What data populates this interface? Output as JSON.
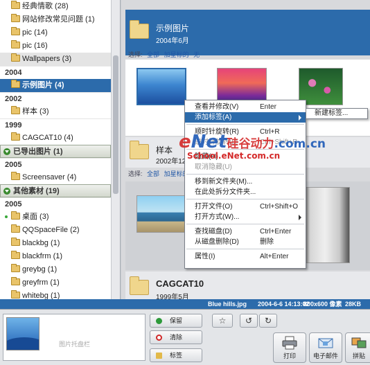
{
  "sidebar": {
    "rows": [
      {
        "kind": "item",
        "label": "经典情歌 (28)"
      },
      {
        "kind": "item",
        "label": "网站修改常见问题 (1)"
      },
      {
        "kind": "item",
        "label": "pic (14)"
      },
      {
        "kind": "item",
        "label": "pic (16)"
      },
      {
        "kind": "item",
        "label": "Wallpapers (3)",
        "state": "hover"
      },
      {
        "kind": "year",
        "label": "2004"
      },
      {
        "kind": "item",
        "label": "示例图片 (4)",
        "state": "selected"
      },
      {
        "kind": "year",
        "label": "2002"
      },
      {
        "kind": "item",
        "label": "样本 (3)"
      },
      {
        "kind": "year",
        "label": "1999"
      },
      {
        "kind": "item",
        "label": "CAGCAT10 (4)"
      },
      {
        "kind": "group",
        "label": "已导出图片 (1)"
      },
      {
        "kind": "year",
        "label": "2005"
      },
      {
        "kind": "item",
        "label": "Screensaver (4)"
      },
      {
        "kind": "group",
        "label": "其他素材 (19)"
      },
      {
        "kind": "year",
        "label": "2005"
      },
      {
        "kind": "item",
        "label": "桌面 (3)",
        "dot": true
      },
      {
        "kind": "item",
        "label": "QQSpaceFile (2)"
      },
      {
        "kind": "item",
        "label": "blackbg (1)"
      },
      {
        "kind": "item",
        "label": "blackfrm (1)"
      },
      {
        "kind": "item",
        "label": "greybg (1)"
      },
      {
        "kind": "item",
        "label": "greyfrm (1)"
      },
      {
        "kind": "item",
        "label": "whitebg (1)"
      },
      {
        "kind": "item",
        "label": "whitefrm (1)"
      }
    ]
  },
  "main": {
    "section1": {
      "title": "示例图片",
      "date": "2004年6月"
    },
    "select_bar": {
      "prefix": "选择:",
      "all": "全部",
      "starred": "加星标的",
      "none": "无"
    },
    "section2": {
      "title": "样本",
      "date": "2002年12"
    },
    "section3": {
      "title": "CAGCAT10",
      "date": "1999年5月"
    }
  },
  "status_bar": {
    "filename": "Blue hills.jpg",
    "datetime": "2004-6-6 14:13:02",
    "dimensions": "800x600 像素",
    "filesize": "28KB"
  },
  "tray": {
    "preview_caption": "图片托盘栏",
    "hold_label": "保留",
    "clear_label": "清除",
    "tag_label": "标签",
    "print_label": "打印",
    "email_label": "电子邮件",
    "collage_label": "拼贴"
  },
  "context_menu": {
    "items": [
      {
        "label": "查看并修改(V)",
        "shortcut": "Enter"
      },
      {
        "label": "添加标签(A)",
        "submenu": true,
        "active": true
      },
      {
        "sep": true
      },
      {
        "label": "顺时针旋转(R)",
        "shortcut": "Ctrl+R"
      },
      {
        "label": "逆时针旋转(L)",
        "shortcut": "Ctrl+Shift+R",
        "disabled": true
      },
      {
        "sep": true
      },
      {
        "label": "隐藏(H)"
      },
      {
        "label": "取消隐藏(U)",
        "disabled": true
      },
      {
        "sep": true
      },
      {
        "label": "移到新文件夹(M)..."
      },
      {
        "label": "在此处拆分文件夹..."
      },
      {
        "sep": true
      },
      {
        "label": "打开文件(O)",
        "shortcut": "Ctrl+Shift+O"
      },
      {
        "label": "打开方式(W)...",
        "submenu": true
      },
      {
        "sep": true
      },
      {
        "label": "查找磁盘(D)",
        "shortcut": "Ctrl+Enter"
      },
      {
        "label": "从磁盘删除(D)",
        "shortcut": "删除"
      },
      {
        "sep": true
      },
      {
        "label": "属性(I)",
        "shortcut": "Alt+Enter"
      }
    ],
    "submenu_item": "新建标签..."
  },
  "watermark": {
    "line1_e": "e",
    "line1_net": "Net",
    "line1_cn": "硅谷动力",
    "line1_domain": ".com.cn",
    "line2": "School.eNet.com.cn"
  },
  "colors": {
    "accent": "#2c6bab",
    "folder": "#e9c46a",
    "group_toggle": "#3a8a2f"
  }
}
